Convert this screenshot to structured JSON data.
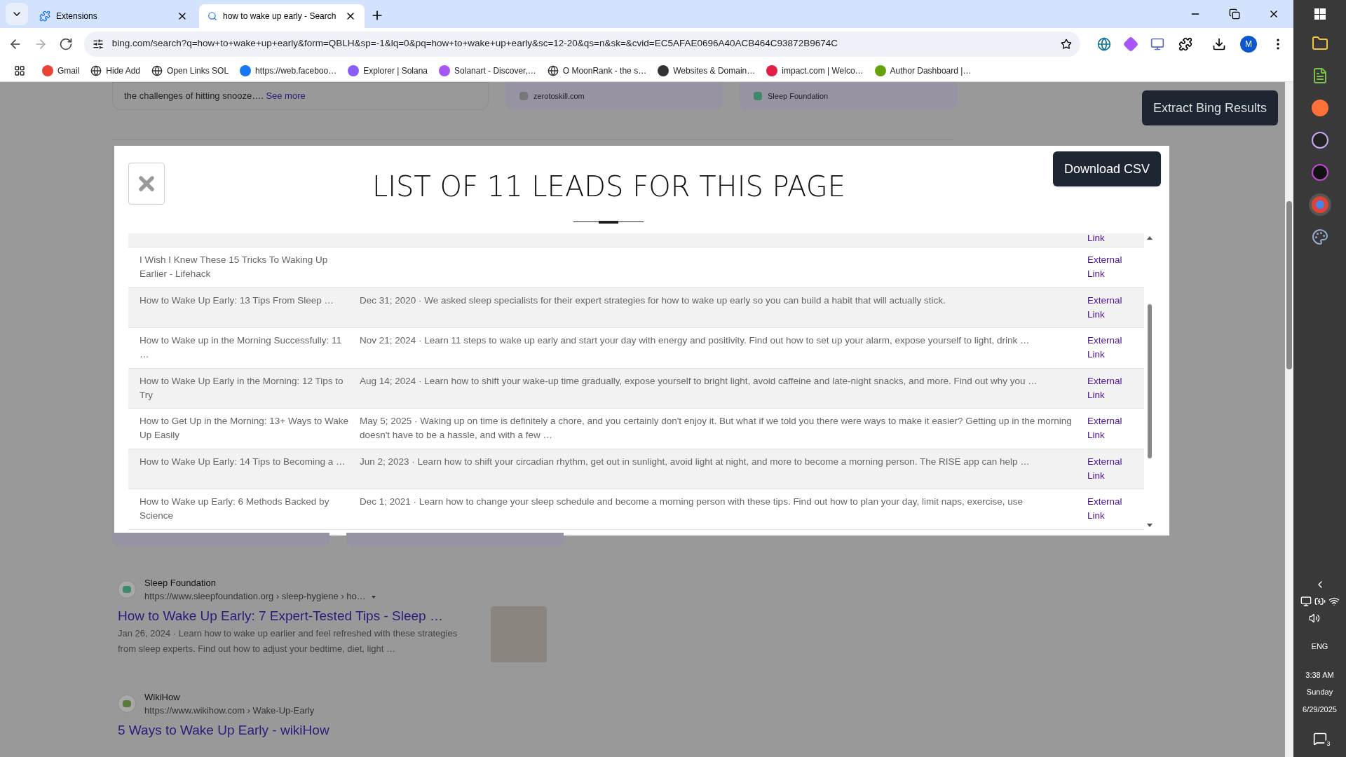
{
  "browser": {
    "tabs": [
      {
        "title": "Extensions",
        "selected": false
      },
      {
        "title": "how to wake up early - Search",
        "selected": true
      }
    ],
    "url": "bing.com/search?q=how+to+wake+up+early&form=QBLH&sp=-1&lq=0&pq=how+to+wake+up+early&sc=12-20&qs=n&sk=&cvid=EC5AFAE0696A40ACB464C93872B9674C",
    "profile_initial": "M",
    "bookmarks": [
      "Gmail",
      "Hide Add",
      "Open Links SOL",
      "https://web.faceboo…",
      "Explorer | Solana",
      "Solanart - Discover,…",
      "O MoonRank - the s…",
      "Websites & Domain…",
      "impact.com | Welco…",
      "Author Dashboard |…"
    ]
  },
  "page": {
    "top_snippet": {
      "text": "the challenges of hitting snooze….",
      "link": "See more"
    },
    "source_cards": [
      "zerotoskill.com",
      "Sleep Foundation"
    ],
    "extract_button": "Extract Bing Results",
    "results": [
      {
        "site": "Sleep Foundation",
        "url": "https://www.sleepfoundation.org › sleep-hygiene › ho…",
        "title": "How to Wake Up Early: 7 Expert-Tested Tips - Sleep …",
        "snippet": "Jan 26, 2024 · Learn how to wake up earlier and feel refreshed with these strategies from sleep experts. Find out how to adjust your bedtime, diet, light …"
      },
      {
        "site": "WikiHow",
        "url": "https://www.wikihow.com › Wake-Up-Early",
        "title": "5 Ways to Wake Up Early - wikiHow"
      }
    ]
  },
  "modal": {
    "title": "LIST OF 11 LEADS FOR THIS PAGE",
    "download_button": "Download CSV",
    "rows": [
      {
        "link": "Link"
      },
      {
        "title": "I Wish I Knew These 15 Tricks To Waking Up Earlier - Lifehack",
        "link": "External Link"
      },
      {
        "title": "How to Wake Up Early: 13 Tips From Sleep …",
        "description": "Dec 31; 2020 · We asked sleep specialists for their expert strategies for how to wake up early so you can build a habit that will actually stick.",
        "link": "External Link"
      },
      {
        "title": "How to Wake up in the Morning Successfully: 11 …",
        "description": "Nov 21; 2024 · Learn 11 steps to wake up early and start your day with energy and positivity. Find out how to set up your alarm, expose yourself to light, drink …",
        "link": "External Link"
      },
      {
        "title": "How to Wake Up Early in the Morning: 12 Tips to Try",
        "description": "Aug 14; 2024 · Learn how to shift your wake-up time gradually, expose yourself to bright light, avoid caffeine and late-night snacks, and more. Find out why you …",
        "link": "External Link"
      },
      {
        "title": "How to Get Up in the Morning: 13+ Ways to Wake Up Easily",
        "description": "May 5; 2025 · Waking up on time is definitely a chore, and you certainly don't enjoy it. But what if we told you there were ways to make it easier? Getting up in the morning doesn't have to be a hassle, and with a few …",
        "link": "External Link"
      },
      {
        "title": "How to Wake Up Early: 14 Tips to Becoming a …",
        "description": "Jun 2; 2023 · Learn how to shift your circadian rhythm, get out in sunlight, avoid light at night, and more to become a morning person. The RISE app can help …",
        "link": "External Link"
      },
      {
        "title": "How to Wake up Early: 6 Methods Backed by Science",
        "description": "Dec 1; 2021 · Learn how to change your sleep schedule and become a morning person with these tips. Find out how to plan your day, limit naps, exercise, use",
        "link": "External Link"
      }
    ]
  },
  "taskbar": {
    "language": "ENG",
    "time": "3:38 AM",
    "day": "Sunday",
    "date": "6/29/2025",
    "notifications": "3"
  }
}
